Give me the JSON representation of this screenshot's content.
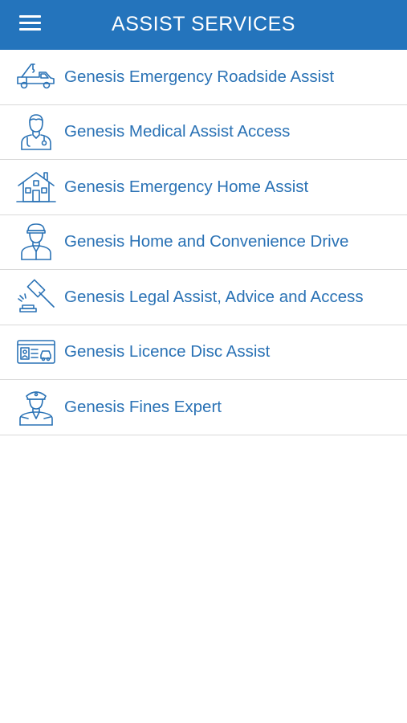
{
  "header": {
    "title": "ASSIST SERVICES",
    "background": "#2474bc",
    "menu_icon": "hamburger-menu-icon"
  },
  "accent_text_color": "#2a72b5",
  "services": [
    {
      "label": "Genesis Emergency Roadside Assist",
      "icon": "tow-truck-icon"
    },
    {
      "label": "Genesis Medical Assist Access",
      "icon": "doctor-icon"
    },
    {
      "label": "Genesis Emergency Home Assist",
      "icon": "house-icon"
    },
    {
      "label": "Genesis Home and Convenience Drive",
      "icon": "chauffeur-icon"
    },
    {
      "label": "Genesis Legal Assist, Advice and Access",
      "icon": "gavel-icon"
    },
    {
      "label": "Genesis Licence Disc Assist",
      "icon": "licence-disc-icon"
    },
    {
      "label": "Genesis Fines Expert",
      "icon": "police-officer-icon"
    }
  ]
}
